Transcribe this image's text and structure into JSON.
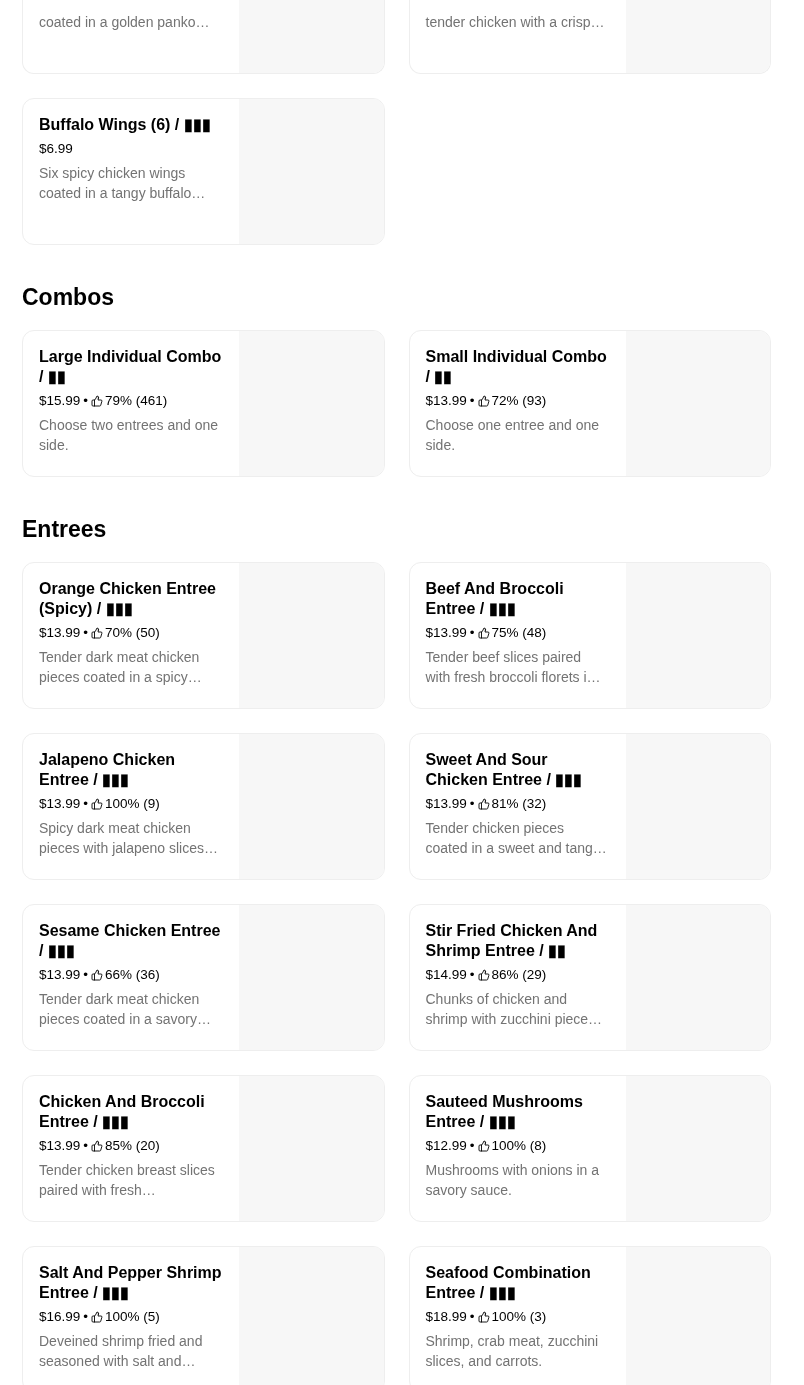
{
  "sections": [
    {
      "items": [
        {
          "kind": "partial",
          "description": "coated in a golden panko…"
        },
        {
          "kind": "partial",
          "description": "tender chicken with a crisp…"
        },
        {
          "kind": "full",
          "name": "Buffalo Wings (6) / ▮▮▮",
          "price": "$6.99",
          "description": "Six spicy chicken wings coated in a tangy buffalo…"
        }
      ]
    },
    {
      "title": "Combos",
      "items": [
        {
          "kind": "full",
          "name": "Large Individual Combo / ▮▮",
          "price": "$15.99",
          "separator": "•",
          "rating": "79% (461)",
          "description": "Choose two entrees and one side."
        },
        {
          "kind": "full",
          "name": "Small Individual Combo / ▮▮",
          "price": "$13.99",
          "separator": "•",
          "rating": "72% (93)",
          "description": "Choose one entree and one side."
        }
      ]
    },
    {
      "title": "Entrees",
      "items": [
        {
          "kind": "full",
          "name": "Orange Chicken Entree (Spicy) / ▮▮▮",
          "price": "$13.99",
          "separator": "•",
          "rating": "70% (50)",
          "description": "Tender dark meat chicken pieces coated in a spicy…"
        },
        {
          "kind": "full",
          "name": "Beef And Broccoli Entree / ▮▮▮",
          "price": "$13.99",
          "separator": "•",
          "rating": "75% (48)",
          "description": "Tender beef slices paired with fresh broccoli florets i…"
        },
        {
          "kind": "full",
          "name": "Jalapeno Chicken Entree / ▮▮▮",
          "price": "$13.99",
          "separator": "•",
          "rating": "100% (9)",
          "description": "Spicy dark meat chicken pieces with jalapeno slices…"
        },
        {
          "kind": "full",
          "name": "Sweet And Sour Chicken Entree / ▮▮▮",
          "price": "$13.99",
          "separator": "•",
          "rating": "81% (32)",
          "description": "Tender chicken pieces coated in a sweet and tang…"
        },
        {
          "kind": "full",
          "name": "Sesame Chicken Entree / ▮▮▮",
          "price": "$13.99",
          "separator": "•",
          "rating": "66% (36)",
          "description": "Tender dark meat chicken pieces coated in a savory…"
        },
        {
          "kind": "full",
          "name": "Stir Fried Chicken And Shrimp Entree / ▮▮",
          "price": "$14.99",
          "separator": "•",
          "rating": "86% (29)",
          "description": "Chunks of chicken and shrimp with zucchini piece…"
        },
        {
          "kind": "full",
          "name": "Chicken And Broccoli Entree / ▮▮▮",
          "price": "$13.99",
          "separator": "•",
          "rating": "85% (20)",
          "description": "Tender chicken breast slices paired with fresh…"
        },
        {
          "kind": "full",
          "name": "Sauteed Mushrooms Entree / ▮▮▮",
          "price": "$12.99",
          "separator": "•",
          "rating": "100% (8)",
          "description": "Mushrooms with onions in a savory sauce."
        },
        {
          "kind": "full",
          "name": "Salt And Pepper Shrimp Entree / ▮▮▮",
          "price": "$16.99",
          "separator": "•",
          "rating": "100% (5)",
          "description": "Deveined shrimp fried and seasoned with salt and…"
        },
        {
          "kind": "full",
          "name": "Seafood Combination Entree / ▮▮▮",
          "price": "$18.99",
          "separator": "•",
          "rating": "100% (3)",
          "description": "Shrimp, crab meat, zucchini slices, and carrots."
        }
      ]
    }
  ]
}
